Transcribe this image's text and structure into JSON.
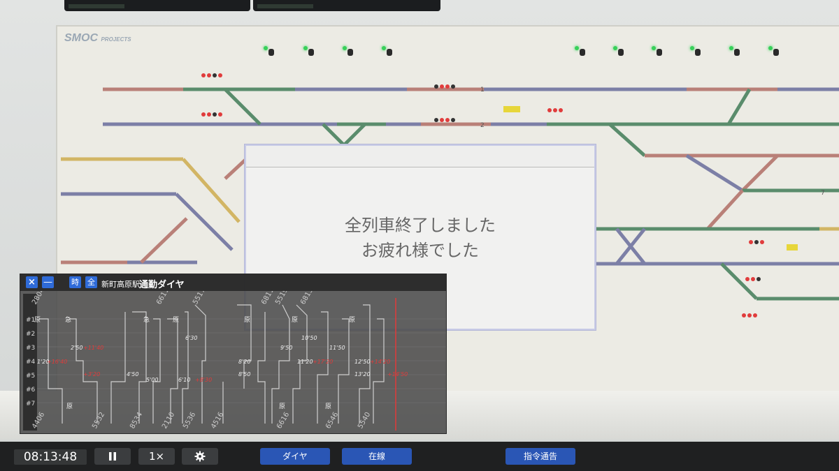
{
  "dialog": {
    "line1": "全列車終了しました",
    "line2": "お疲れ様でした"
  },
  "diagram_window": {
    "close_icon": "×",
    "minimize_icon": "—",
    "time_button": "時",
    "all_button": "全",
    "station": "新町高原駅",
    "title": "通勤ダイヤ",
    "tracks": [
      "#1",
      "#2",
      "#3",
      "#4",
      "#5",
      "#6",
      "#7"
    ],
    "train_numbers_top": [
      "2804",
      "6611",
      "5517",
      "6811",
      "5519",
      "6813"
    ],
    "train_numbers_bottom": [
      "4406",
      "5532",
      "8534",
      "2110",
      "5536",
      "4516",
      "6616",
      "6546",
      "5540"
    ],
    "type_labels_top": [
      "原",
      "急",
      "急",
      "原",
      "原",
      "原",
      "原"
    ],
    "type_labels_bottom": [
      "原",
      "原",
      "原"
    ],
    "time_labels": [
      "1'20",
      "2'50",
      "4'50",
      "5'00",
      "6'10",
      "6'30",
      "8'20",
      "8'50",
      "9'50",
      "10'50",
      "11'20",
      "11'50",
      "12'50",
      "13'20"
    ],
    "delay_labels": [
      "+16'40",
      "+11'40",
      "+3'20",
      "+8'30",
      "+14'20",
      "+17'20",
      "+14'50"
    ]
  },
  "toolbar": {
    "clock": "08:13:48",
    "pause_icon": "pause-icon",
    "speed": "1×",
    "settings_icon": "gear-icon",
    "diagram_button": "ダイヤ",
    "onwire_button": "在線",
    "dispatch_button": "指令通告"
  },
  "panel": {
    "logo": "SMOC",
    "logo_sub": "PROJECTS",
    "track_label_1": "1",
    "track_label_2": "2",
    "track_label_7": "7"
  },
  "colors": {
    "accent_blue": "#2a56b5",
    "delay_red": "#e03a3a",
    "track_green": "#5a8c6c",
    "track_purple": "#7c7fa6",
    "track_red": "#b98078",
    "track_yellow": "#d2b564"
  }
}
